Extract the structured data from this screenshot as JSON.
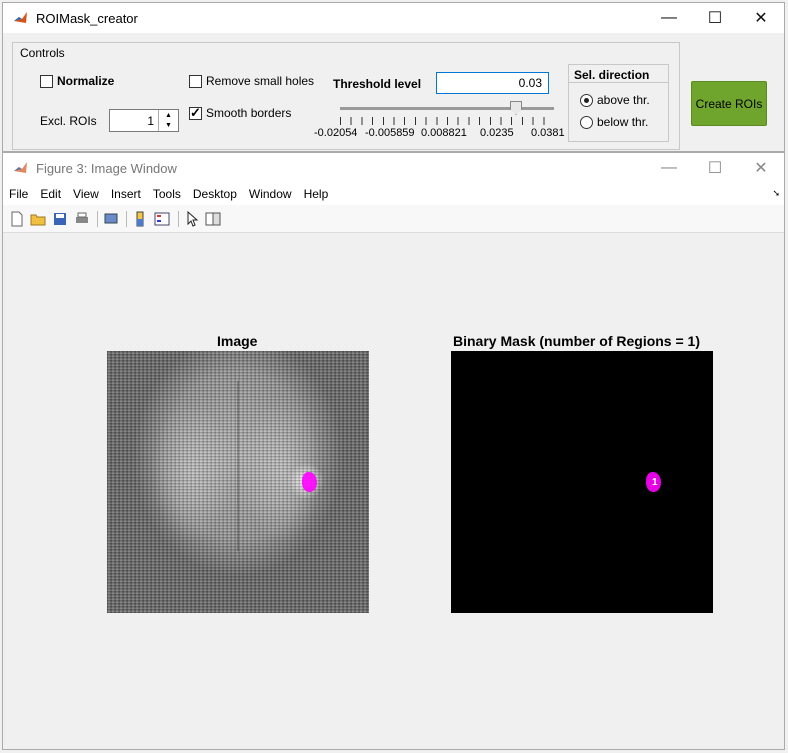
{
  "app_window": {
    "title": "ROIMask_creator",
    "controls_label": "Controls",
    "normalize_label": "Normalize",
    "remove_holes_label": "Remove small holes",
    "smooth_label": "Smooth borders",
    "excl_label": "Excl. ROIs",
    "excl_value": "1",
    "threshold_label": "Threshold level",
    "threshold_value": "0.03",
    "slider_level": 0.84,
    "tick_labels": [
      "-0.02054",
      "-0.005859",
      "0.008821",
      "0.0235",
      "0.0381"
    ],
    "direction_title": "Sel. direction",
    "above_label": "above thr.",
    "below_label": "below thr.",
    "create_label": "Create ROIs",
    "create_color": "#70a52d"
  },
  "figure_window": {
    "title": "Figure 3: Image Window",
    "menu": [
      "File",
      "Edit",
      "View",
      "Insert",
      "Tools",
      "Desktop",
      "Window",
      "Help"
    ],
    "toolbar_icons": [
      "new-file-icon",
      "open-folder-icon",
      "save-icon",
      "print-icon",
      "print-preview-icon",
      "colorbar-icon",
      "legend-icon",
      "pointer-icon",
      "property-editor-icon"
    ],
    "left_axes_title": "Image",
    "right_axes_title": "Binary Mask (number of Regions = 1)",
    "region_label": "1",
    "roi_color": "#ff00ff"
  }
}
